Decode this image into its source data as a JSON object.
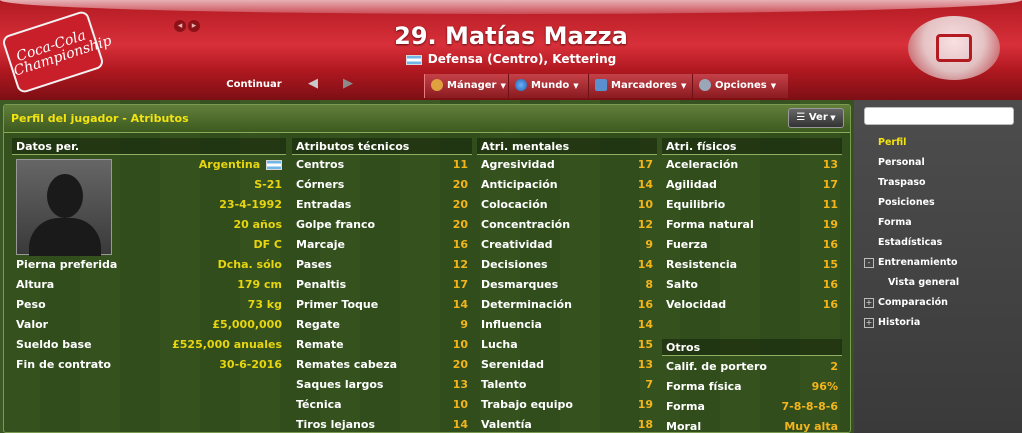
{
  "header": {
    "title": "29. Matías Mazza",
    "subtitle": "Defensa (Centro), Kettering",
    "logo_text": "Coca-Cola Championship"
  },
  "toolbar": {
    "continue_label": "Continuar",
    "menus": [
      {
        "label": "Mánager",
        "icon": "manager-icon"
      },
      {
        "label": "Mundo",
        "icon": "globe-icon"
      },
      {
        "label": "Marcadores",
        "icon": "bookmark-icon"
      },
      {
        "label": "Opciones",
        "icon": "gear-icon"
      }
    ]
  },
  "panel": {
    "title": "Perfil del jugador - Atributos",
    "ver_label": "Ver"
  },
  "personal": {
    "header": "Datos per.",
    "nationality": "Argentina",
    "squad": "S-21",
    "birth_date": "23-4-1992",
    "age": "20 años",
    "position": "DF C",
    "rows": [
      {
        "label": "Pierna preferida",
        "value": "Dcha. sólo"
      },
      {
        "label": "Altura",
        "value": "179 cm"
      },
      {
        "label": "Peso",
        "value": "73 kg"
      },
      {
        "label": "Valor",
        "value": "£5,000,000"
      },
      {
        "label": "Sueldo base",
        "value": "£525,000 anuales"
      },
      {
        "label": "Fin de contrato",
        "value": "30-6-2016"
      }
    ]
  },
  "technical": {
    "header": "Atributos técnicos",
    "rows": [
      {
        "label": "Centros",
        "value": "11"
      },
      {
        "label": "Córners",
        "value": "20"
      },
      {
        "label": "Entradas",
        "value": "20"
      },
      {
        "label": "Golpe franco",
        "value": "20"
      },
      {
        "label": "Marcaje",
        "value": "16"
      },
      {
        "label": "Pases",
        "value": "12"
      },
      {
        "label": "Penaltis",
        "value": "17"
      },
      {
        "label": "Primer Toque",
        "value": "14"
      },
      {
        "label": "Regate",
        "value": "9"
      },
      {
        "label": "Remate",
        "value": "10"
      },
      {
        "label": "Remates cabeza",
        "value": "20"
      },
      {
        "label": "Saques largos",
        "value": "13"
      },
      {
        "label": "Técnica",
        "value": "10"
      },
      {
        "label": "Tiros lejanos",
        "value": "14"
      }
    ]
  },
  "mental": {
    "header": "Atri. mentales",
    "rows": [
      {
        "label": "Agresividad",
        "value": "17"
      },
      {
        "label": "Anticipación",
        "value": "14"
      },
      {
        "label": "Colocación",
        "value": "10"
      },
      {
        "label": "Concentración",
        "value": "12"
      },
      {
        "label": "Creatividad",
        "value": "9"
      },
      {
        "label": "Decisiones",
        "value": "14"
      },
      {
        "label": "Desmarques",
        "value": "8"
      },
      {
        "label": "Determinación",
        "value": "16"
      },
      {
        "label": "Influencia",
        "value": "14"
      },
      {
        "label": "Lucha",
        "value": "15"
      },
      {
        "label": "Serenidad",
        "value": "13"
      },
      {
        "label": "Talento",
        "value": "7"
      },
      {
        "label": "Trabajo equipo",
        "value": "19"
      },
      {
        "label": "Valentía",
        "value": "18"
      }
    ]
  },
  "physical": {
    "header": "Atri. físicos",
    "rows": [
      {
        "label": "Aceleración",
        "value": "13"
      },
      {
        "label": "Agilidad",
        "value": "17"
      },
      {
        "label": "Equilibrio",
        "value": "11"
      },
      {
        "label": "Forma natural",
        "value": "19"
      },
      {
        "label": "Fuerza",
        "value": "16"
      },
      {
        "label": "Resistencia",
        "value": "15"
      },
      {
        "label": "Salto",
        "value": "16"
      },
      {
        "label": "Velocidad",
        "value": "16"
      }
    ]
  },
  "others": {
    "header": "Otros",
    "rows": [
      {
        "label": "Calif. de portero",
        "value": "2"
      },
      {
        "label": "Forma física",
        "value": "96%"
      },
      {
        "label": "Forma",
        "value": "7-8-8-8-6"
      },
      {
        "label": "Moral",
        "value": "Muy alta"
      }
    ]
  },
  "sidebar": {
    "items": [
      {
        "label": "Perfil",
        "active": true
      },
      {
        "label": "Personal"
      },
      {
        "label": "Traspaso"
      },
      {
        "label": "Posiciones"
      },
      {
        "label": "Forma"
      },
      {
        "label": "Estadísticas"
      },
      {
        "label": "Entrenamiento",
        "expander": "-"
      },
      {
        "label": "Vista general",
        "indent": true
      },
      {
        "label": "Comparación",
        "expander": "+"
      },
      {
        "label": "Historia",
        "expander": "+"
      }
    ]
  }
}
